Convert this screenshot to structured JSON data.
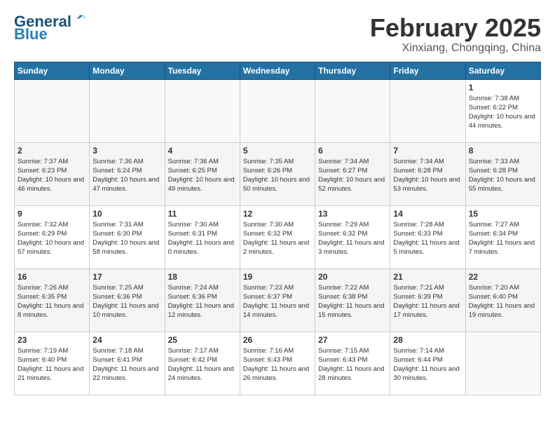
{
  "header": {
    "logo_line1": "General",
    "logo_line2": "Blue",
    "title": "February 2025",
    "subtitle": "Xinxiang, Chongqing, China"
  },
  "weekdays": [
    "Sunday",
    "Monday",
    "Tuesday",
    "Wednesday",
    "Thursday",
    "Friday",
    "Saturday"
  ],
  "weeks": [
    [
      {
        "day": "",
        "info": ""
      },
      {
        "day": "",
        "info": ""
      },
      {
        "day": "",
        "info": ""
      },
      {
        "day": "",
        "info": ""
      },
      {
        "day": "",
        "info": ""
      },
      {
        "day": "",
        "info": ""
      },
      {
        "day": "1",
        "info": "Sunrise: 7:38 AM\nSunset: 6:22 PM\nDaylight: 10 hours and 44 minutes."
      }
    ],
    [
      {
        "day": "2",
        "info": "Sunrise: 7:37 AM\nSunset: 6:23 PM\nDaylight: 10 hours and 46 minutes."
      },
      {
        "day": "3",
        "info": "Sunrise: 7:36 AM\nSunset: 6:24 PM\nDaylight: 10 hours and 47 minutes."
      },
      {
        "day": "4",
        "info": "Sunrise: 7:36 AM\nSunset: 6:25 PM\nDaylight: 10 hours and 49 minutes."
      },
      {
        "day": "5",
        "info": "Sunrise: 7:35 AM\nSunset: 6:26 PM\nDaylight: 10 hours and 50 minutes."
      },
      {
        "day": "6",
        "info": "Sunrise: 7:34 AM\nSunset: 6:27 PM\nDaylight: 10 hours and 52 minutes."
      },
      {
        "day": "7",
        "info": "Sunrise: 7:34 AM\nSunset: 6:28 PM\nDaylight: 10 hours and 53 minutes."
      },
      {
        "day": "8",
        "info": "Sunrise: 7:33 AM\nSunset: 6:28 PM\nDaylight: 10 hours and 55 minutes."
      }
    ],
    [
      {
        "day": "9",
        "info": "Sunrise: 7:32 AM\nSunset: 6:29 PM\nDaylight: 10 hours and 57 minutes."
      },
      {
        "day": "10",
        "info": "Sunrise: 7:31 AM\nSunset: 6:30 PM\nDaylight: 10 hours and 58 minutes."
      },
      {
        "day": "11",
        "info": "Sunrise: 7:30 AM\nSunset: 6:31 PM\nDaylight: 11 hours and 0 minutes."
      },
      {
        "day": "12",
        "info": "Sunrise: 7:30 AM\nSunset: 6:32 PM\nDaylight: 11 hours and 2 minutes."
      },
      {
        "day": "13",
        "info": "Sunrise: 7:29 AM\nSunset: 6:32 PM\nDaylight: 11 hours and 3 minutes."
      },
      {
        "day": "14",
        "info": "Sunrise: 7:28 AM\nSunset: 6:33 PM\nDaylight: 11 hours and 5 minutes."
      },
      {
        "day": "15",
        "info": "Sunrise: 7:27 AM\nSunset: 6:34 PM\nDaylight: 11 hours and 7 minutes."
      }
    ],
    [
      {
        "day": "16",
        "info": "Sunrise: 7:26 AM\nSunset: 6:35 PM\nDaylight: 11 hours and 8 minutes."
      },
      {
        "day": "17",
        "info": "Sunrise: 7:25 AM\nSunset: 6:36 PM\nDaylight: 11 hours and 10 minutes."
      },
      {
        "day": "18",
        "info": "Sunrise: 7:24 AM\nSunset: 6:36 PM\nDaylight: 11 hours and 12 minutes."
      },
      {
        "day": "19",
        "info": "Sunrise: 7:23 AM\nSunset: 6:37 PM\nDaylight: 11 hours and 14 minutes."
      },
      {
        "day": "20",
        "info": "Sunrise: 7:22 AM\nSunset: 6:38 PM\nDaylight: 11 hours and 15 minutes."
      },
      {
        "day": "21",
        "info": "Sunrise: 7:21 AM\nSunset: 6:39 PM\nDaylight: 11 hours and 17 minutes."
      },
      {
        "day": "22",
        "info": "Sunrise: 7:20 AM\nSunset: 6:40 PM\nDaylight: 11 hours and 19 minutes."
      }
    ],
    [
      {
        "day": "23",
        "info": "Sunrise: 7:19 AM\nSunset: 6:40 PM\nDaylight: 11 hours and 21 minutes."
      },
      {
        "day": "24",
        "info": "Sunrise: 7:18 AM\nSunset: 6:41 PM\nDaylight: 11 hours and 22 minutes."
      },
      {
        "day": "25",
        "info": "Sunrise: 7:17 AM\nSunset: 6:42 PM\nDaylight: 11 hours and 24 minutes."
      },
      {
        "day": "26",
        "info": "Sunrise: 7:16 AM\nSunset: 6:43 PM\nDaylight: 11 hours and 26 minutes."
      },
      {
        "day": "27",
        "info": "Sunrise: 7:15 AM\nSunset: 6:43 PM\nDaylight: 11 hours and 28 minutes."
      },
      {
        "day": "28",
        "info": "Sunrise: 7:14 AM\nSunset: 6:44 PM\nDaylight: 11 hours and 30 minutes."
      },
      {
        "day": "",
        "info": ""
      }
    ]
  ]
}
